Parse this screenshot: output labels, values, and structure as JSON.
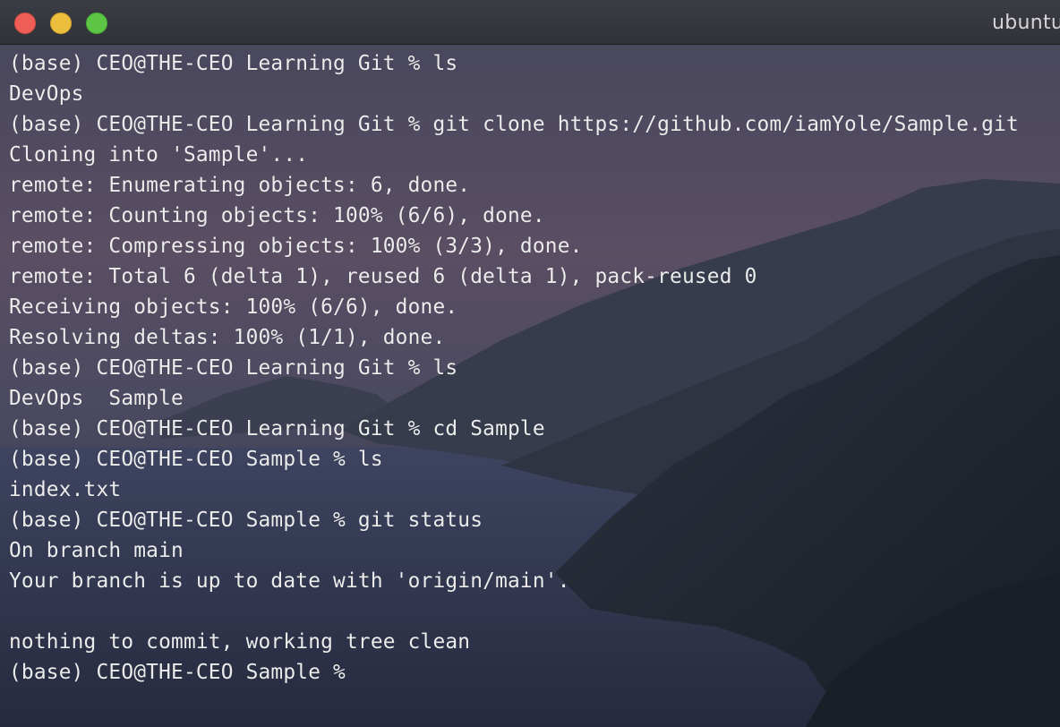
{
  "window": {
    "title": "ubuntu",
    "controls": {
      "close_color": "#ee5e57",
      "minimize_color": "#ebbe3c",
      "zoom_color": "#5cc644"
    }
  },
  "terminal": {
    "lines": [
      "(base) CEO@THE-CEO Learning Git % ls",
      "DevOps",
      "(base) CEO@THE-CEO Learning Git % git clone https://github.com/iamYole/Sample.git",
      "Cloning into 'Sample'...",
      "remote: Enumerating objects: 6, done.",
      "remote: Counting objects: 100% (6/6), done.",
      "remote: Compressing objects: 100% (3/3), done.",
      "remote: Total 6 (delta 1), reused 6 (delta 1), pack-reused 0",
      "Receiving objects: 100% (6/6), done.",
      "Resolving deltas: 100% (1/1), done.",
      "(base) CEO@THE-CEO Learning Git % ls",
      "DevOps  Sample",
      "(base) CEO@THE-CEO Learning Git % cd Sample",
      "(base) CEO@THE-CEO Sample % ls",
      "index.txt",
      "(base) CEO@THE-CEO Sample % git status",
      "On branch main",
      "Your branch is up to date with 'origin/main'.",
      "",
      "nothing to commit, working tree clean",
      "(base) CEO@THE-CEO Sample % "
    ]
  },
  "colors": {
    "text": "#ececec",
    "titlebar": "#35363c"
  }
}
